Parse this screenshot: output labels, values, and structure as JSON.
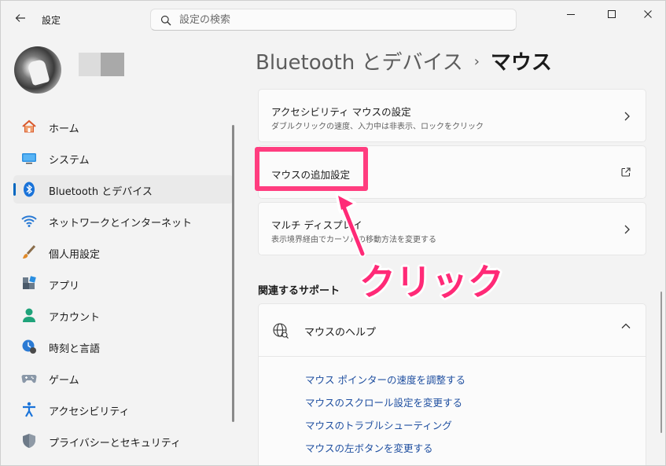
{
  "app": {
    "title": "設定"
  },
  "search": {
    "placeholder": "設定の検索"
  },
  "sidebar": {
    "items": [
      {
        "label": "ホーム"
      },
      {
        "label": "システム"
      },
      {
        "label": "Bluetooth とデバイス"
      },
      {
        "label": "ネットワークとインターネット"
      },
      {
        "label": "個人用設定"
      },
      {
        "label": "アプリ"
      },
      {
        "label": "アカウント"
      },
      {
        "label": "時刻と言語"
      },
      {
        "label": "ゲーム"
      },
      {
        "label": "アクセシビリティ"
      },
      {
        "label": "プライバシーとセキュリティ"
      }
    ]
  },
  "breadcrumb": {
    "parent": "Bluetooth とデバイス",
    "separator": "›",
    "current": "マウス"
  },
  "cards": {
    "accessibility_mouse": {
      "title": "アクセシビリティ マウスの設定",
      "subtitle": "ダブルクリックの速度、入力中は非表示、ロックをクリック"
    },
    "additional_mouse": {
      "title": "マウスの追加設定"
    },
    "multi_display": {
      "title": "マルチ ディスプレイ",
      "subtitle": "表示境界経由でカーソルの移動方法を変更する"
    }
  },
  "support": {
    "section_title": "関連するサポート",
    "help_title": "マウスのヘルプ",
    "links": [
      "マウス ポインターの速度を調整する",
      "マウスのスクロール設定を変更する",
      "マウスのトラブルシューティング",
      "マウスの左ボタンを変更する"
    ]
  },
  "annotation": {
    "text": "クリック",
    "color": "#ff2a77"
  },
  "colors": {
    "accent": "#0067c0",
    "highlight": "#ff3d7f",
    "link": "#1f4fa0"
  }
}
